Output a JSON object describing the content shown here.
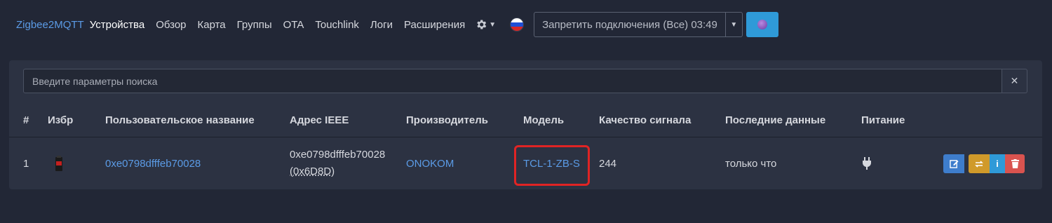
{
  "nav": {
    "brand": "Zigbee2MQTT",
    "links": [
      "Устройства",
      "Обзор",
      "Карта",
      "Группы",
      "OTA",
      "Touchlink",
      "Логи",
      "Расширения"
    ],
    "active_index": 0,
    "settings_icon": "gear-icon",
    "language_flag": "russian-flag-icon",
    "permit_join_label": "Запретить подключения (Все) 03:49",
    "theme_icon": "theme-icon"
  },
  "search": {
    "placeholder": "Введите параметры поиска",
    "clear_icon": "close-icon"
  },
  "table": {
    "columns": [
      "#",
      "Избр",
      "Пользовательское название",
      "Адрес IEEE",
      "Производитель",
      "Модель",
      "Качество сигнала",
      "Последние данные",
      "Питание"
    ],
    "rows": [
      {
        "index": "1",
        "friendly_name": "0xe0798dfffeb70028",
        "ieee_address": "0xe0798dfffeb70028",
        "network_address": "(0x6D8D)",
        "manufacturer": "ONOKOM",
        "model": "TCL-1-ZB-S",
        "link_quality": "244",
        "last_seen": "только что",
        "power_icon": "plug-icon",
        "actions": [
          "edit-icon",
          "rename-icon",
          "info-icon",
          "trash-icon"
        ]
      }
    ]
  },
  "colors": {
    "background": "#222736",
    "card": "#2c3242",
    "link": "#5b9be6",
    "highlight_border": "#e02424",
    "btn_edit": "#3e7dcc",
    "btn_rename": "#d09a2a",
    "btn_info": "#2f9ad8",
    "btn_delete": "#d9534f"
  }
}
